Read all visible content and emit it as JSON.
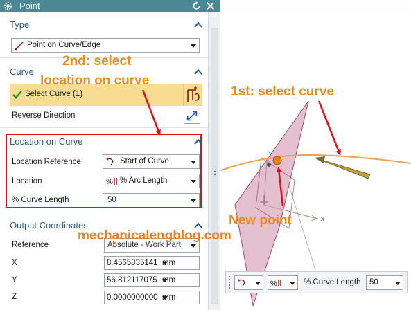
{
  "window": {
    "title": "Point"
  },
  "type_section": {
    "heading": "Type",
    "selected": "Point on Curve/Edge"
  },
  "curve_section": {
    "heading": "Curve",
    "select_label": "Select Curve (1)",
    "reverse_label": "Reverse Direction"
  },
  "location_section": {
    "heading": "Location on Curve",
    "rows": [
      {
        "label": "Location Reference",
        "value": "Start of Curve"
      },
      {
        "label": "Location",
        "value": "% Arc Length"
      },
      {
        "label": "% Curve Length",
        "value": "50"
      }
    ]
  },
  "output_section": {
    "heading": "Output Coordinates",
    "reference_label": "Reference",
    "reference_value": "Absolute - Work Part",
    "coords": [
      {
        "label": "X",
        "value": "8.45658351414",
        "unit": "mm"
      },
      {
        "label": "Y",
        "value": "56.8121170752",
        "unit": "mm"
      },
      {
        "label": "Z",
        "value": "0.00000000000",
        "unit": "mm"
      }
    ]
  },
  "viewport": {
    "axis_x": "X",
    "axis_y": "Y",
    "toolbar": {
      "label": "% Curve Length",
      "value": "50"
    }
  },
  "annotations": {
    "step2": "2nd: select",
    "step2b": "location on curve",
    "step1": "1st: select curve",
    "new_point": "New point",
    "watermark": "mechanicalengblog.com"
  },
  "colors": {
    "titlebar": "#4a8994",
    "section_heading": "#2a5a8a",
    "selection_highlight": "#f8dc91",
    "callout_border": "#e0101a",
    "annotation_text": "#ee8a1a",
    "plane_fill": "#d9a9c0",
    "curve": "#f0a050"
  },
  "icons": [
    "gear-icon",
    "reset-icon",
    "close-icon",
    "collapse-icon",
    "curve-type-icon",
    "check-icon",
    "select-curve-icon",
    "reverse-direction-icon",
    "location-reference-icon",
    "percent-arc-icon"
  ]
}
